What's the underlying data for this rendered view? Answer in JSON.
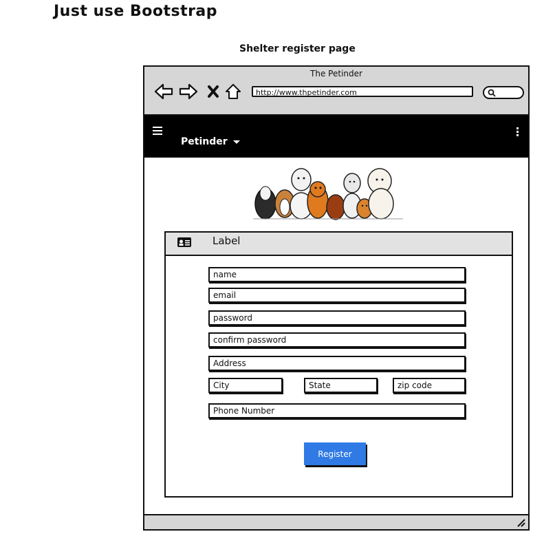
{
  "page": {
    "heading": "Just use Bootstrap",
    "subheading": "Shelter register page"
  },
  "browser": {
    "title": "The Petinder",
    "url": "http://www.thpetinder.com",
    "icons": [
      "back-arrow-icon",
      "forward-arrow-icon",
      "close-icon",
      "home-icon",
      "search-icon"
    ]
  },
  "navbar": {
    "brand": "Petinder",
    "icons": [
      "hamburger-menu-icon",
      "dropdown-caret-icon",
      "kebab-menu-icon"
    ]
  },
  "panel": {
    "icon": "id-card-icon",
    "label": "Label"
  },
  "form": {
    "name": "name",
    "email": "email",
    "password": "password",
    "confirm_password": "confirm password",
    "address": "Address",
    "city": "City",
    "state": "State",
    "zip": "zip code",
    "phone": "Phone Number",
    "register_label": "Register"
  },
  "colors": {
    "navbar_bg": "#000000",
    "chrome_bg": "#d6d6d6",
    "button_bg": "#2f7ae5"
  }
}
